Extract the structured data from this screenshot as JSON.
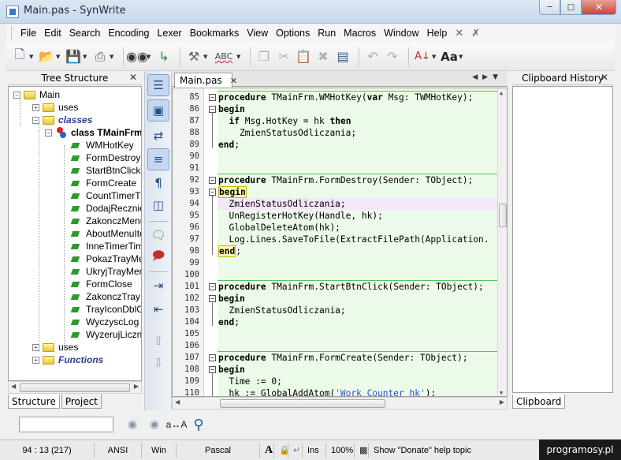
{
  "window": {
    "title": "Main.pas - SynWrite",
    "controls": [
      "minimize",
      "maximize",
      "close"
    ]
  },
  "menu": {
    "items": [
      "File",
      "Edit",
      "Search",
      "Encoding",
      "Lexer",
      "Bookmarks",
      "View",
      "Options",
      "Run",
      "Macros",
      "Window",
      "Help"
    ]
  },
  "toolbar": {
    "spell_label": "ABC"
  },
  "tree_panel": {
    "title": "Tree Structure",
    "nodes": [
      {
        "text": "Main",
        "type": "folder",
        "expanded": true,
        "bold": false,
        "italic": false
      },
      {
        "text": "uses",
        "type": "folder",
        "expanded": false
      },
      {
        "text": "classes",
        "type": "folder",
        "expanded": true,
        "bold": true,
        "italic": true,
        "color": "#2a3f8f"
      },
      {
        "text": "class TMainFrm",
        "type": "class",
        "expanded": true,
        "bold": true
      },
      {
        "text": "WMHotKey",
        "type": "method"
      },
      {
        "text": "FormDestroy",
        "type": "method"
      },
      {
        "text": "StartBtnClick",
        "type": "method"
      },
      {
        "text": "FormCreate",
        "type": "method"
      },
      {
        "text": "CountTimerTimer",
        "type": "method"
      },
      {
        "text": "DodajRecznie",
        "type": "method"
      },
      {
        "text": "ZakonczMenu",
        "type": "method"
      },
      {
        "text": "AboutMenuItem",
        "type": "method"
      },
      {
        "text": "InneTimerTimer",
        "type": "method"
      },
      {
        "text": "PokazTrayMenu",
        "type": "method"
      },
      {
        "text": "UkryjTrayMenu",
        "type": "method"
      },
      {
        "text": "FormClose",
        "type": "method"
      },
      {
        "text": "ZakonczTray",
        "type": "method"
      },
      {
        "text": "TrayIconDblClick",
        "type": "method"
      },
      {
        "text": "WyczyscLog",
        "type": "method"
      },
      {
        "text": "WyzerujLiczniki",
        "type": "method"
      },
      {
        "text": "uses",
        "type": "folder",
        "expanded": false
      },
      {
        "text": "Functions",
        "type": "folder",
        "expanded": false,
        "bold": true,
        "italic": true,
        "color": "#2a3f8f"
      }
    ],
    "tabs": [
      "Structure",
      "Project"
    ]
  },
  "editor": {
    "tab_label": "Main.pas",
    "lines": [
      {
        "n": "85",
        "fold": "minus",
        "html": "<span class='kw'>procedure</span> TMainFrm.WMHotKey(<span class='kw'>var</span> Msg: TWMHotKey);"
      },
      {
        "n": "86",
        "fold": "minus",
        "html": "<span class='kw'>begin</span>"
      },
      {
        "n": "87",
        "fold": "",
        "html": "  <span class='kw'>if</span> Msg.HotKey = hk <span class='kw'>then</span>"
      },
      {
        "n": "88",
        "fold": "",
        "html": "    ZmienStatusOdliczania;"
      },
      {
        "n": "89",
        "fold": "",
        "html": "<span class='kw'>end</span>;"
      },
      {
        "n": "90",
        "fold": "",
        "html": ""
      },
      {
        "n": "91",
        "fold": "",
        "html": ""
      },
      {
        "n": "92",
        "fold": "minus",
        "html": "<span class='kw'>procedure</span> TMainFrm.FormDestroy(Sender: TObject);"
      },
      {
        "n": "93",
        "fold": "minus",
        "html": "<span class='kw beginbox'>begin</span>"
      },
      {
        "n": "94",
        "fold": "",
        "html": "  ZmienStatusOdliczania;"
      },
      {
        "n": "95",
        "fold": "",
        "html": "  UnRegisterHotKey(Handle, hk);"
      },
      {
        "n": "96",
        "fold": "",
        "html": "  GlobalDeleteAtom(hk);"
      },
      {
        "n": "97",
        "fold": "",
        "html": "  Log.Lines.SaveToFile(ExtractFilePath(Application."
      },
      {
        "n": "98",
        "fold": "",
        "html": "<span class='kw beginbox'>end</span>;"
      },
      {
        "n": "99",
        "fold": "",
        "html": ""
      },
      {
        "n": "100",
        "fold": "",
        "html": ""
      },
      {
        "n": "101",
        "fold": "minus",
        "html": "<span class='kw'>procedure</span> TMainFrm.StartBtnClick(Sender: TObject);"
      },
      {
        "n": "102",
        "fold": "minus",
        "html": "<span class='kw'>begin</span>"
      },
      {
        "n": "103",
        "fold": "",
        "html": "  ZmienStatusOdliczania;"
      },
      {
        "n": "104",
        "fold": "",
        "html": "<span class='kw'>end</span>;"
      },
      {
        "n": "105",
        "fold": "",
        "html": ""
      },
      {
        "n": "106",
        "fold": "",
        "html": ""
      },
      {
        "n": "107",
        "fold": "minus",
        "html": "<span class='kw'>procedure</span> TMainFrm.FormCreate(Sender: TObject);"
      },
      {
        "n": "108",
        "fold": "minus",
        "html": "<span class='kw'>begin</span>"
      },
      {
        "n": "109",
        "fold": "",
        "html": "  Time := 0;"
      },
      {
        "n": "110",
        "fold": "",
        "html": "  hk := GlobalAddAtom(<span class='str'>'Work Counter hk'</span>);"
      }
    ]
  },
  "clipboard_panel": {
    "title": "Clipboard History",
    "tab": "Clipboard"
  },
  "statusbar": {
    "position": "94 : 13 (217)",
    "encoding": "ANSI",
    "line_ending": "Win",
    "lexer": "Pascal",
    "mode": "Ins",
    "zoom": "100%",
    "hint": "Show \"Donate\" help topic"
  },
  "watermark": "programosy.pl"
}
